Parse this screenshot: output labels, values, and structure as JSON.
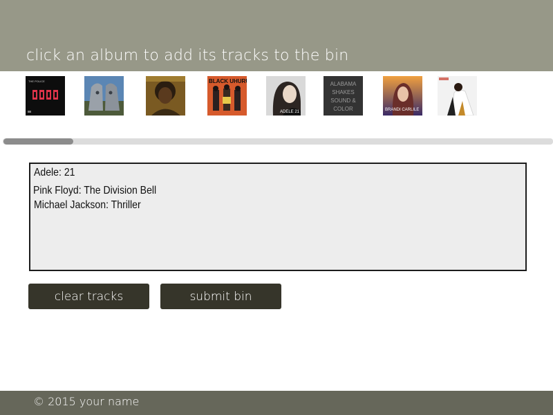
{
  "header": {
    "title": "click an album to add its tracks to the bin"
  },
  "albums": [
    {
      "name": "album-police",
      "icon": "album-cover-police",
      "cover_text": "THE POLICE"
    },
    {
      "name": "album-pink-floyd",
      "icon": "album-cover-pink-floyd"
    },
    {
      "name": "album-ziggy",
      "icon": "album-cover-portrait"
    },
    {
      "name": "album-black-uhuru",
      "icon": "album-cover-black-uhuru",
      "cover_text": "BLACK UHURU"
    },
    {
      "name": "album-adele",
      "icon": "album-cover-adele",
      "cover_text": "ADELE 21"
    },
    {
      "name": "album-alabama-shakes",
      "icon": "album-cover-alabama-shakes",
      "cover_text": "ALABAMA SHAKES SOUND & COLOR"
    },
    {
      "name": "album-brandi-carlile",
      "icon": "album-cover-brandi-carlile",
      "cover_text": "BRANDI CARLILE"
    },
    {
      "name": "album-michael-jackson",
      "icon": "album-cover-thriller"
    }
  ],
  "bin": {
    "tracks": [
      "Adele: 21",
      "Pink Floyd: The Division Bell",
      "Michael Jackson: Thriller"
    ]
  },
  "buttons": {
    "clear": "clear tracks",
    "submit": "submit bin"
  },
  "footer": {
    "text": "©  2015 your name"
  },
  "colors": {
    "header_bg": "#979888",
    "button_bg": "#36352a",
    "footer_bg": "#66675a",
    "bin_bg": "#ededed"
  }
}
